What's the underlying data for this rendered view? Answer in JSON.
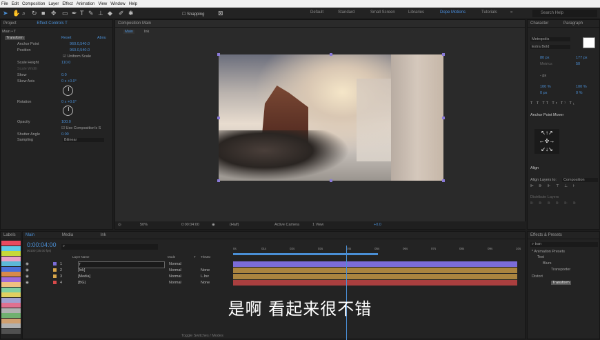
{
  "menu": [
    "File",
    "Edit",
    "Composition",
    "Layer",
    "Effect",
    "Animation",
    "View",
    "Window",
    "Help"
  ],
  "toolbar": {
    "snapping": "Snapping",
    "workspaces": [
      "Default",
      "Standard",
      "Small Screen",
      "Libraries",
      "Dope Motions",
      "Tutorials"
    ],
    "search_placeholder": "Search Help"
  },
  "left_panel": {
    "tabs": [
      "Project",
      "Effect Controls T"
    ],
    "subtitle": "Main • T",
    "section": "Transform",
    "reset": "Reset",
    "about": "Abou",
    "props": [
      {
        "label": "Anchor Point",
        "value": "960.0,540.0"
      },
      {
        "label": "Position",
        "value": "960.0,540.0"
      },
      {
        "label": "",
        "value": "Uniform Scale"
      },
      {
        "label": "Scale Height",
        "value": "110.0"
      },
      {
        "label": "Scale Width",
        "value": ""
      },
      {
        "label": "Skew",
        "value": "0.0"
      },
      {
        "label": "Skew Axis",
        "value": "0 x +0.0°"
      },
      {
        "label": "Rotation",
        "value": "0 x +0.0°"
      },
      {
        "label": "Opacity",
        "value": "100.0"
      },
      {
        "label": "",
        "value": "Use Composition's S"
      },
      {
        "label": "Shutter Angle",
        "value": "0.00"
      },
      {
        "label": "Sampling",
        "value": "Bilinear"
      }
    ]
  },
  "viewer": {
    "tab": "Composition Main",
    "subtabs": [
      "Main",
      "Ink"
    ],
    "zoom": "50%",
    "timecode": "0:00:04:00",
    "resolution": "(Half)",
    "camera": "Active Camera",
    "views": "1 View",
    "exposure": "+0.0"
  },
  "character": {
    "tabs": [
      "Character",
      "Paragraph"
    ],
    "font": "Metropolis",
    "style": "Extra Bold",
    "size": "80 px",
    "tracking": "177 px",
    "leading_label": "Metrics",
    "kerning": "50",
    "stroke": "- px",
    "vscale": "100 %",
    "hscale": "100 %",
    "baseline": "0 px",
    "tsume": "0 %",
    "anchor_mover": "Anchor Point Mover",
    "align": "Align",
    "align_to_label": "Align Layers to:",
    "align_to": "Composition",
    "distribute": "Distribute Layers"
  },
  "effects": {
    "title": "Effects & Presets",
    "search": "tran",
    "tree": [
      "* Animation Presets",
      "Text",
      "Blurs",
      "Transporter",
      "Distort",
      "Transform"
    ]
  },
  "labels": {
    "title": "Labels",
    "colors": [
      "#e84a5f",
      "#5ec8e6",
      "#c6d93a",
      "#e8a0c6",
      "#5cb8d8",
      "#4a6fd8",
      "#d88a4a",
      "#a06ad8",
      "#f0c080",
      "#80d0a0",
      "#e0d060",
      "#a0a0d0",
      "#e07090",
      "#b0b0b0",
      "#70b070",
      "#d0a070",
      "#b0b0b0",
      "#505050"
    ]
  },
  "timeline": {
    "tabs": [
      "Main",
      "Media",
      "Ink"
    ],
    "timecode": "0:00:04:00",
    "frame": "00100 (25.00 fps)",
    "search": "",
    "columns": [
      "Layer Name",
      "Mode",
      "T",
      "TrkMat"
    ],
    "ticks": [
      "0s",
      "01s",
      "02s",
      "03s",
      "04s",
      "05s",
      "06s",
      "07s",
      "08s",
      "09s",
      "10s"
    ],
    "layers": [
      {
        "num": "1",
        "name": "T",
        "mode": "Normal",
        "trk": "",
        "color": "#7b6cd8"
      },
      {
        "num": "2",
        "name": "[Ink]",
        "mode": "Normal",
        "trk": "None",
        "color": "#d8a64a"
      },
      {
        "num": "3",
        "name": "[Media]",
        "mode": "Normal",
        "trk": "L.Inv",
        "color": "#d8a64a"
      },
      {
        "num": "4",
        "name": "[BG]",
        "mode": "Normal",
        "trk": "None",
        "color": "#d84a4a"
      }
    ],
    "toggle": "Toggle Switches / Modes"
  },
  "subtitle": "是啊 看起来很不错"
}
